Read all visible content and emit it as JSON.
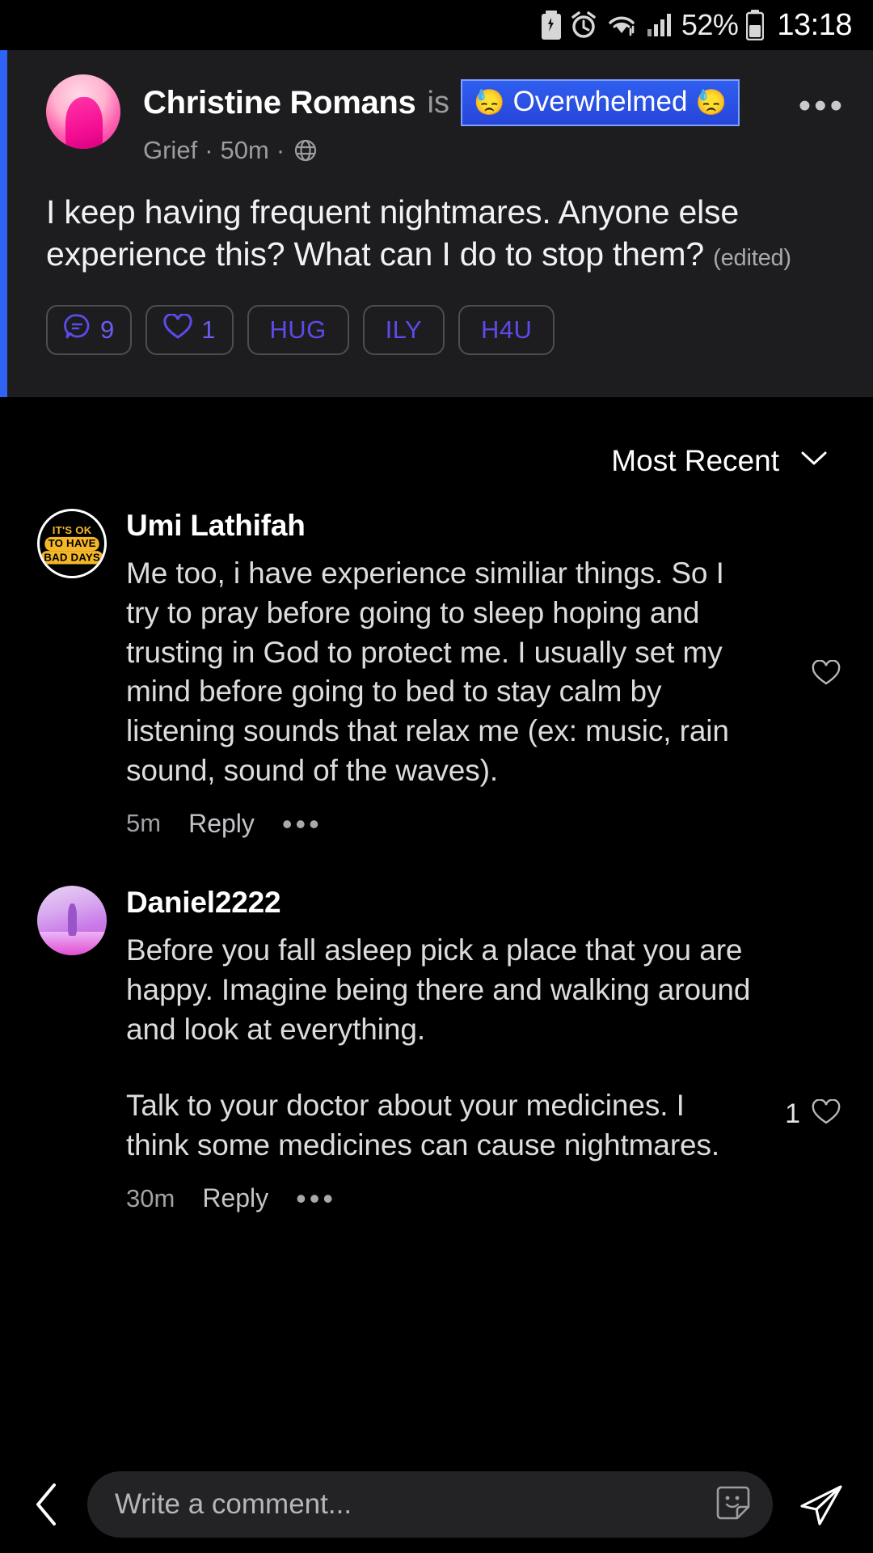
{
  "statusbar": {
    "icons": [
      "battery-saver-icon",
      "alarm-icon",
      "wifi-icon",
      "cellular-signal-icon"
    ],
    "battery_percent": "52%",
    "time": "13:18"
  },
  "post": {
    "author": "Christine Romans",
    "is_word": "is",
    "mood": {
      "label": "Overwhelmed",
      "emoji_left": "😓",
      "emoji_right": "😓",
      "bg_color": "#2f5ef0"
    },
    "group": "Grief",
    "age": "50m",
    "privacy_icon": "globe-icon",
    "meta_separator": "·",
    "more_options": "•••",
    "body": "I keep having frequent nightmares. Anyone else experience this? What can I do to stop them?",
    "edited_label": "(edited)",
    "accent_bar_color": "#2f63f5",
    "reactions": [
      {
        "icon": "comment-icon",
        "count": "9",
        "name": "comments-chip"
      },
      {
        "icon": "heart-icon",
        "count": "1",
        "name": "likes-chip"
      },
      {
        "icon": "",
        "label": "HUG",
        "name": "hug-chip"
      },
      {
        "icon": "",
        "label": "ILY",
        "name": "ily-chip"
      },
      {
        "icon": "",
        "label": "H4U",
        "name": "h4u-chip"
      }
    ]
  },
  "sort": {
    "label": "Most Recent",
    "chevron_icon": "chevron-down-icon"
  },
  "comments": [
    {
      "author": "Umi Lathifah",
      "avatar_type": "text-badge",
      "avatar_text_lines": [
        "IT'S OK",
        "TO HAVE",
        "BAD DAYS"
      ],
      "paragraphs": [
        "Me too, i have experience similiar things. So I try to pray before going to sleep hoping and trusting in God to protect me.  I usually set my mind before going to bed to stay calm by listening sounds that relax me (ex: music, rain sound, sound of the waves)."
      ],
      "time": "5m",
      "reply_label": "Reply",
      "more_options": "•••",
      "like_count": "",
      "like_icon": "heart-outline-icon"
    },
    {
      "author": "Daniel2222",
      "avatar_type": "photo",
      "paragraphs": [
        "Before you fall asleep pick a place that you are happy. Imagine being there and walking around and look at everything.",
        "Talk to your doctor about your medicines. I think some medicines can cause nightmares."
      ],
      "time": "30m",
      "reply_label": "Reply",
      "more_options": "•••",
      "like_count": "1",
      "like_icon": "heart-outline-icon"
    }
  ],
  "bottombar": {
    "back_icon": "back-chevron-icon",
    "input_placeholder": "Write a comment...",
    "input_value": "",
    "sticker_icon": "sticker-icon",
    "send_icon": "send-icon"
  }
}
